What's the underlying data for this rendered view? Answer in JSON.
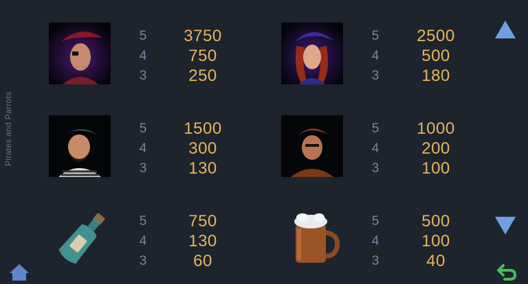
{
  "game_title": "Pirates and Parrots",
  "paytable": [
    {
      "symbol": "captain-portrait",
      "payouts": [
        {
          "count": "5",
          "value": "3750"
        },
        {
          "count": "4",
          "value": "750"
        },
        {
          "count": "3",
          "value": "250"
        }
      ]
    },
    {
      "symbol": "lady-pirate-portrait",
      "payouts": [
        {
          "count": "5",
          "value": "2500"
        },
        {
          "count": "4",
          "value": "500"
        },
        {
          "count": "3",
          "value": "180"
        }
      ]
    },
    {
      "symbol": "bearded-pirate-portrait",
      "payouts": [
        {
          "count": "5",
          "value": "1500"
        },
        {
          "count": "4",
          "value": "300"
        },
        {
          "count": "3",
          "value": "130"
        }
      ]
    },
    {
      "symbol": "sailor-portrait",
      "payouts": [
        {
          "count": "5",
          "value": "1000"
        },
        {
          "count": "4",
          "value": "200"
        },
        {
          "count": "3",
          "value": "100"
        }
      ]
    },
    {
      "symbol": "message-bottle",
      "payouts": [
        {
          "count": "5",
          "value": "750"
        },
        {
          "count": "4",
          "value": "130"
        },
        {
          "count": "3",
          "value": "60"
        }
      ]
    },
    {
      "symbol": "ale-mug",
      "payouts": [
        {
          "count": "5",
          "value": "500"
        },
        {
          "count": "4",
          "value": "100"
        },
        {
          "count": "3",
          "value": "40"
        }
      ]
    }
  ],
  "icons": {
    "scroll_up": "up-arrow-icon",
    "scroll_down": "down-arrow-icon",
    "home": "home-icon",
    "back": "back-arrow-icon"
  },
  "colors": {
    "background": "#1e242d",
    "count_text": "#6f87a6",
    "value_text": "#e8b55c",
    "arrow": "#6f9fe0",
    "back_icon": "#3fbf5a"
  }
}
